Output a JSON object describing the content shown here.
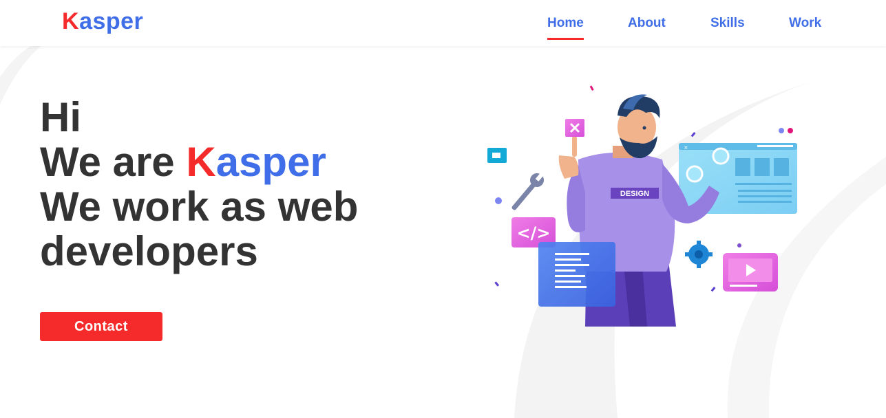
{
  "header": {
    "logo": {
      "first_letter": "K",
      "rest": "asper"
    },
    "nav": [
      {
        "label": "Home",
        "active": true
      },
      {
        "label": "About",
        "active": false
      },
      {
        "label": "Skills",
        "active": false
      },
      {
        "label": "Work",
        "active": false
      }
    ]
  },
  "hero": {
    "line1": "Hi",
    "line2_prefix": "We are ",
    "line2_brand_first": "K",
    "line2_brand_rest": "asper",
    "line3": "We work as web",
    "line4": "developers",
    "contact_label": "Contact"
  },
  "illustration": {
    "shirt_text": "DESIGN",
    "code_tag": "</>"
  },
  "colors": {
    "accent_red": "#f52a2a",
    "accent_blue": "#3f6ee8",
    "text_dark": "#333333"
  }
}
